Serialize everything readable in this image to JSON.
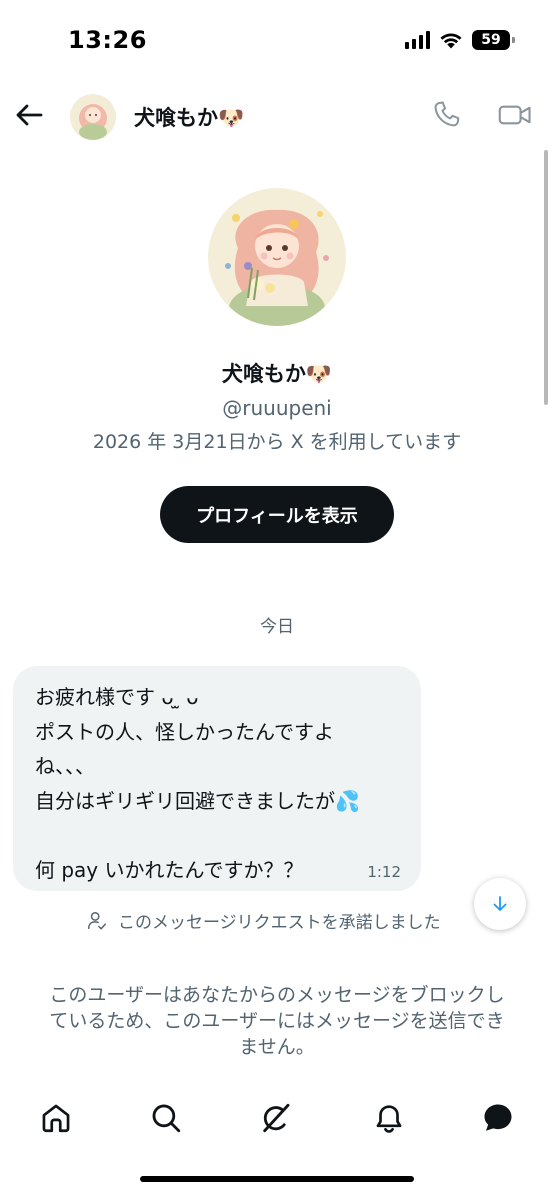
{
  "status_bar": {
    "time": "13:26",
    "battery": "59",
    "icons": [
      "cellular-signal-icon",
      "wifi-icon",
      "battery-icon"
    ]
  },
  "header": {
    "name": "犬喰もか🐶",
    "icons": [
      "back-arrow-icon",
      "phone-icon",
      "video-camera-icon"
    ]
  },
  "profile": {
    "name": "犬喰もか🐶",
    "handle": "@ruuupeni",
    "joined": "2026 年 3月21日から X を利用しています",
    "button_label": "プロフィールを表示"
  },
  "conversation": {
    "date_label": "今日",
    "message": {
      "lines": [
        "お疲れ様です ᴗ ̫ ᴗ",
        "ポストの人、怪しかったんですよ",
        "ね、、、",
        "自分はギリギリ回避できましたが💦",
        "",
        "何 pay いかれたんですか？？"
      ],
      "time": "1:12"
    },
    "accepted_notice": "このメッセージリクエストを承諾しました",
    "blocked_notice_lines": [
      "このユーザーはあなたからのメッセージをブロックし",
      "ているため、このユーザーにはメッセージを送信でき",
      "ません。"
    ]
  },
  "bottom_nav": {
    "items": [
      "home-icon",
      "search-icon",
      "grok-icon",
      "notifications-icon",
      "messages-icon"
    ]
  },
  "colors": {
    "primary_text": "#0f1419",
    "secondary_text": "#536471",
    "bubble_bg": "#eff3f4",
    "accent": "#1d9bf0",
    "button_bg": "#0f1419"
  }
}
